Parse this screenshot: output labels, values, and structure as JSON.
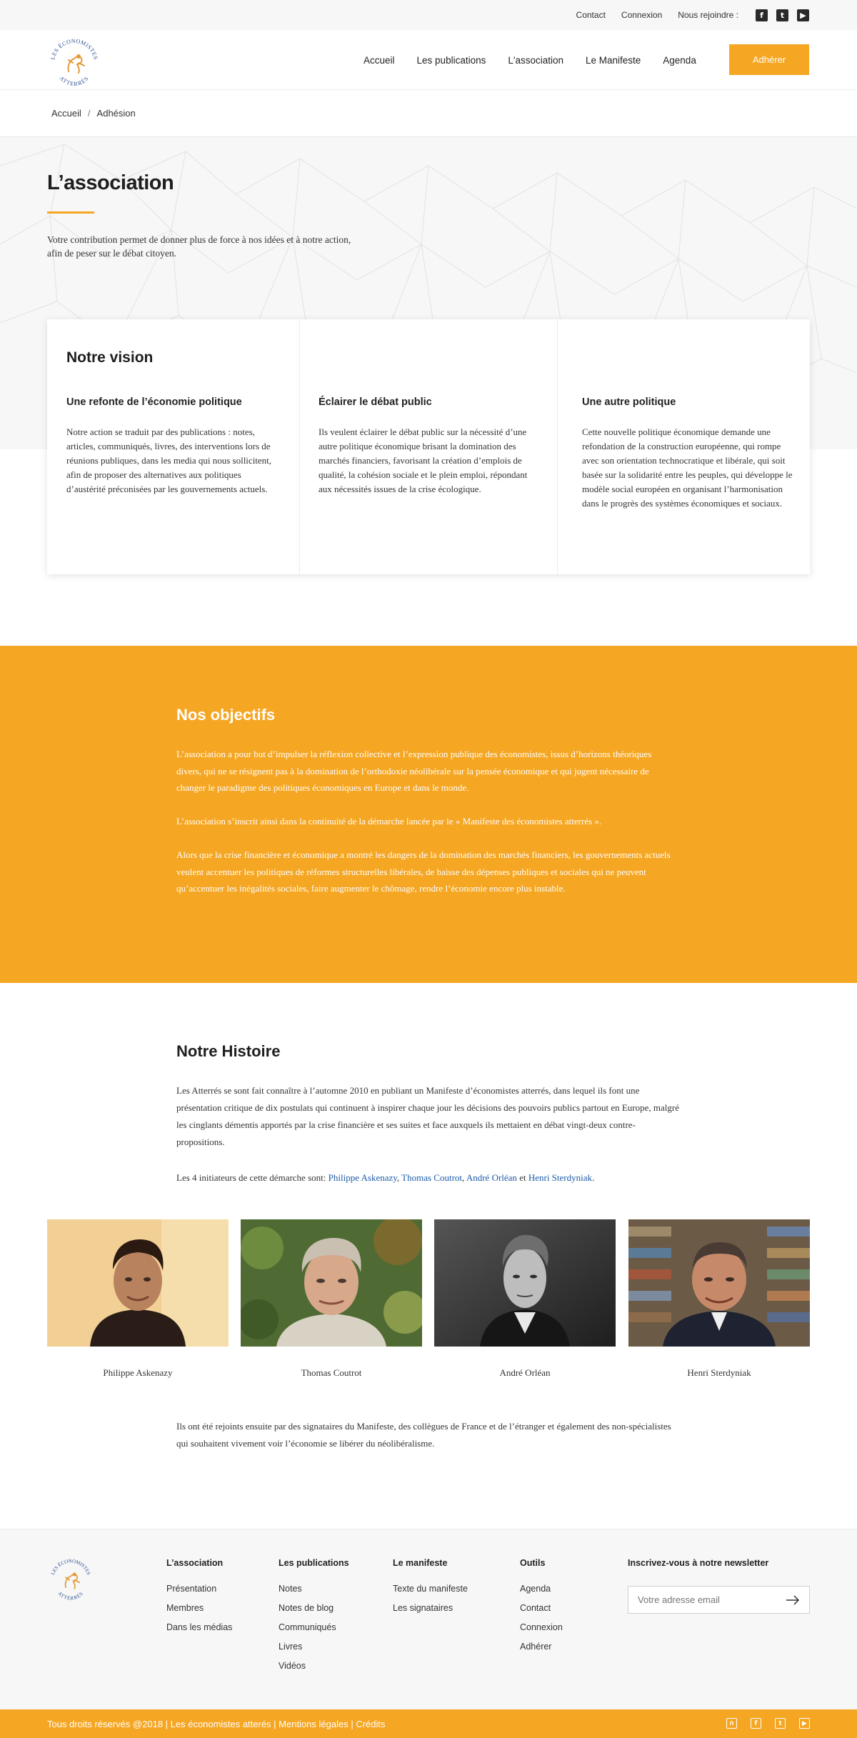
{
  "topbar": {
    "contact": "Contact",
    "login": "Connexion",
    "join_us": "Nous rejoindre :",
    "social": [
      "facebook-icon",
      "twitter-icon",
      "youtube-icon"
    ]
  },
  "header": {
    "logo_text": "LES ÉCONOMISTES ATTERRÉS",
    "nav": [
      "Accueil",
      "Les publications",
      "L'association",
      "Le Manifeste",
      "Agenda"
    ],
    "join_button": "Adhérer"
  },
  "breadcrumb": {
    "home": "Accueil",
    "separator": "/",
    "current": "Adhésion"
  },
  "hero": {
    "title": "L’association",
    "intro": "Votre contribution permet de donner plus de force à nos idées et à notre action, afin de peser sur le débat citoyen."
  },
  "vision": {
    "title": "Notre vision",
    "columns": [
      {
        "heading": "Une refonte de l’économie politique",
        "text": "Notre action se traduit par des publications : notes, articles, communiqués, livres, des interventions lors de réunions publiques, dans les media qui nous sollicitent, afin de proposer des alternatives aux politiques d’austérité préconisées par les gouvernements actuels."
      },
      {
        "heading": "Éclairer le débat public",
        "text": "Ils veulent éclairer le débat public sur la nécessité d’une autre politique économique brisant la domination des marchés financiers, favorisant la création d’emplois de qualité, la cohésion sociale et le plein emploi,  répondant aux nécessités issues de la crise écologique."
      },
      {
        "heading": "Une autre politique",
        "text": "Cette nouvelle politique économique demande une refondation de la construction européenne, qui rompe avec son orientation technocratique et libérale, qui soit basée sur la solidarité entre les peuples, qui développe le modèle social européen en organisant l’harmonisation dans le progrès des systèmes économiques et sociaux."
      }
    ]
  },
  "objectives": {
    "title": "Nos objectifs",
    "paragraphs": [
      "L’association a pour but d’impulser la réflexion collective et l’expression publique des économistes, issus d’horizons théoriques divers, qui ne se résignent pas à la domination de l’orthodoxie néolibérale sur la pensée économique et qui jugent nécessaire de changer le paradigme des politiques économiques en Europe et dans le monde.",
      "L’association s’inscrit  ainsi dans la continuité de la démarche lancée par le « Manifeste des économistes atterrés ».",
      "Alors que la crise financière et économique a montré les dangers de la domination des marchés financiers, les gouvernements actuels veulent accentuer les politiques de réformes structurelles libérales, de baisse des dépenses publiques et sociales qui ne peuvent qu’accentuer les inégalités sociales, faire augmenter le chômage, rendre l’économie encore plus instable."
    ]
  },
  "history": {
    "title": "Notre Histoire",
    "p1": "Les Atterrés se sont fait connaître à l’automne 2010 en publiant un Manifeste d’économistes atterrés, dans lequel ils font une présentation critique de dix postulats qui continuent à inspirer chaque jour les décisions des pouvoirs publics partout en Europe, malgré les cinglants démentis apportés par la crise financière et ses suites et face auxquels ils mettaient en débat vingt-deux contre-propositions.",
    "p2_prefix": "Les 4 initiateurs de cette démarche sont: ",
    "sep_comma": ", ",
    "sep_and": " et ",
    "end": ".",
    "founders": [
      "Philippe Askenazy",
      "Thomas Coutrot",
      "André Orléan",
      "Henri Sterdyniak"
    ],
    "p3": "Ils ont été rejoints ensuite par des signataires du Manifeste, des collègues de France et de l’étranger et également des non-spécialistes qui souhaitent vivement voir l’économie se libérer du néolibéralisme."
  },
  "footer": {
    "columns": [
      {
        "title": "L’association",
        "items": [
          "Présentation",
          "Membres",
          "Dans les médias"
        ]
      },
      {
        "title": "Les publications",
        "items": [
          "Notes",
          "Notes de blog",
          "Communiqués",
          "Livres",
          "Vidéos"
        ]
      },
      {
        "title": "Le manifeste",
        "items": [
          "Texte du manifeste",
          "Les signataires"
        ]
      },
      {
        "title": "Outils",
        "items": [
          "Agenda",
          "Contact",
          "Connexion",
          "Adhérer"
        ]
      }
    ],
    "newsletter_title": "Inscrivez-vous à notre newsletter",
    "newsletter_placeholder": "Votre adresse email",
    "copyright": "Tous droits réservés @2018 | Les économistes atterés | Mentions légales | Crédits",
    "social": [
      "rss-icon",
      "facebook-icon",
      "twitter-icon",
      "youtube-icon"
    ]
  },
  "colors": {
    "accent": "#f5a623",
    "link": "#1a5aa8",
    "text": "#222222",
    "muted_bg": "#f7f7f7"
  }
}
